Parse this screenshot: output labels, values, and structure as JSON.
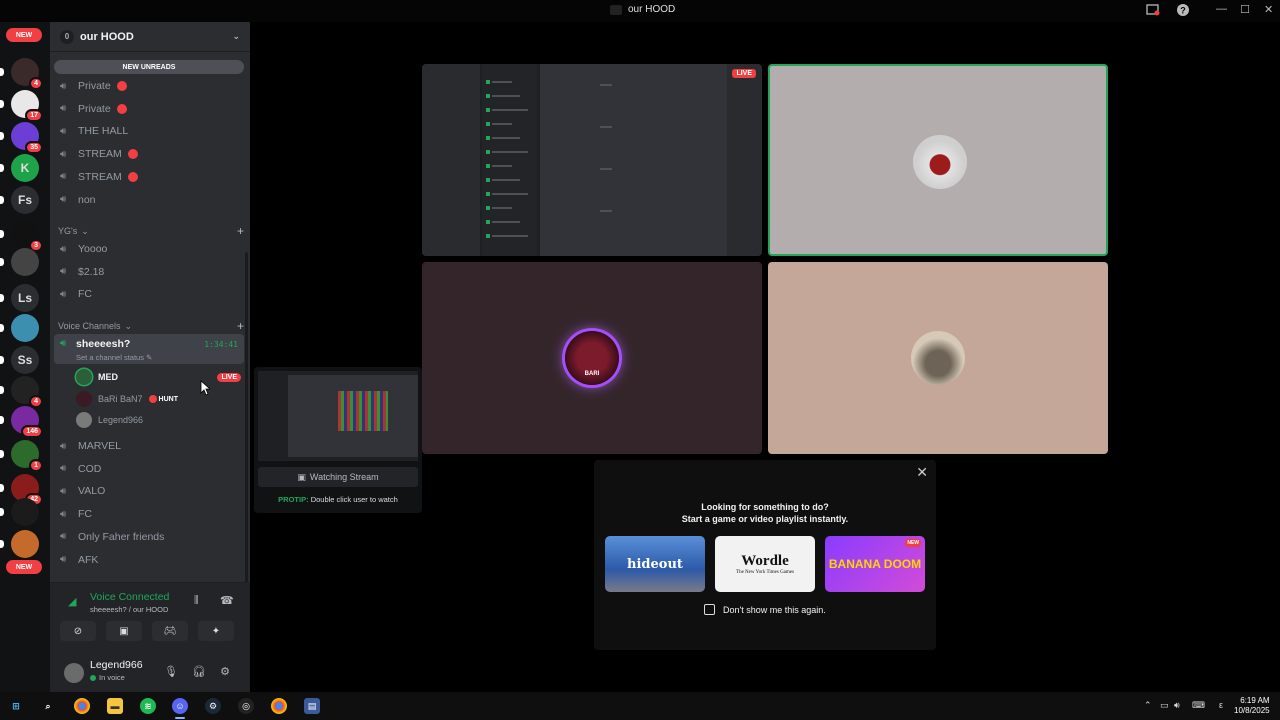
{
  "window": {
    "title": "our HOOD",
    "controls": {
      "minimize": "—",
      "maximize": "☐",
      "close": "✕"
    }
  },
  "servers": {
    "new_top": "NEW",
    "new_bottom": "NEW",
    "items": [
      {
        "label": "",
        "badge": "4",
        "color": "#3a2a2a"
      },
      {
        "label": "",
        "badge": "17",
        "color": "#e8e8e8"
      },
      {
        "label": "",
        "badge": "35",
        "color": "#6b3fd6"
      },
      {
        "label": "K",
        "badge": "",
        "color": "#1fa34a"
      },
      {
        "label": "Fs",
        "badge": "",
        "color": "#2b2d31"
      },
      {
        "label": "",
        "badge": "3",
        "color": "#111"
      },
      {
        "label": "",
        "badge": "",
        "color": "#444"
      },
      {
        "label": "Ls",
        "badge": "",
        "color": "#2b2d31"
      },
      {
        "label": "",
        "badge": "",
        "color": "#3d8fb0"
      },
      {
        "label": "Ss",
        "badge": "",
        "color": "#2b2d31"
      },
      {
        "label": "",
        "badge": "4",
        "color": "#222"
      },
      {
        "label": "",
        "badge": "146",
        "color": "#7a2aa0"
      },
      {
        "label": "",
        "badge": "1",
        "color": "#2c6b2c"
      },
      {
        "label": "",
        "badge": "42",
        "color": "#8a1c1c"
      },
      {
        "label": "",
        "badge": "",
        "color": "#1b1b1b"
      },
      {
        "label": "",
        "badge": "",
        "color": "#c46a2a"
      }
    ]
  },
  "sidebar": {
    "server_name": "our HOOD",
    "new_unreads": "NEW UNREADS",
    "channels_top": [
      {
        "label": "Private",
        "live": true
      },
      {
        "label": "Private",
        "live": true
      },
      {
        "label": "THE HALL",
        "live": false
      },
      {
        "label": "STREAM",
        "live": true
      },
      {
        "label": "STREAM",
        "live": true
      },
      {
        "label": "non",
        "live": false
      }
    ],
    "category_yg": "YG's",
    "channels_yg": [
      "Yoooo",
      "$2.18",
      "FC"
    ],
    "category_voice": "Voice Channels",
    "active_channel": {
      "name": "sheeeesh?",
      "status": "Set a channel status",
      "timer": "1:34:41"
    },
    "voice_users": [
      {
        "name": "MED",
        "tag": "LIVE"
      },
      {
        "name": "BaRi BaN7",
        "tag": "HUNT"
      },
      {
        "name": "Legend966",
        "tag": ""
      }
    ],
    "channels_voice": [
      "MARVEL",
      "COD",
      "VALO",
      "FC",
      "Only Faher friends",
      "AFK"
    ]
  },
  "voice_panel": {
    "title": "Voice Connected",
    "subtitle": "sheeeesh? / our HOOD"
  },
  "user_panel": {
    "name": "Legend966",
    "status": "In voice"
  },
  "stage": {
    "tile1_live": "LIVE",
    "tile3_label": "BARI"
  },
  "stream_preview": {
    "watching": "Watching Stream",
    "protip_label": "PROTIP:",
    "protip_text": "Double click user to watch"
  },
  "activity_popup": {
    "line1": "Looking for something to do?",
    "line2": "Start a game or video playlist instantly.",
    "games": [
      {
        "name": "hideout"
      },
      {
        "name": "Wordle",
        "sub": "The New York Times Games"
      },
      {
        "name": "BANANA DOOM",
        "tag": "NEW"
      }
    ],
    "dont_show": "Don't show me this again."
  },
  "taskbar": {
    "time": "6:19 AM",
    "date": "10/8/2025",
    "lang": "ε"
  }
}
